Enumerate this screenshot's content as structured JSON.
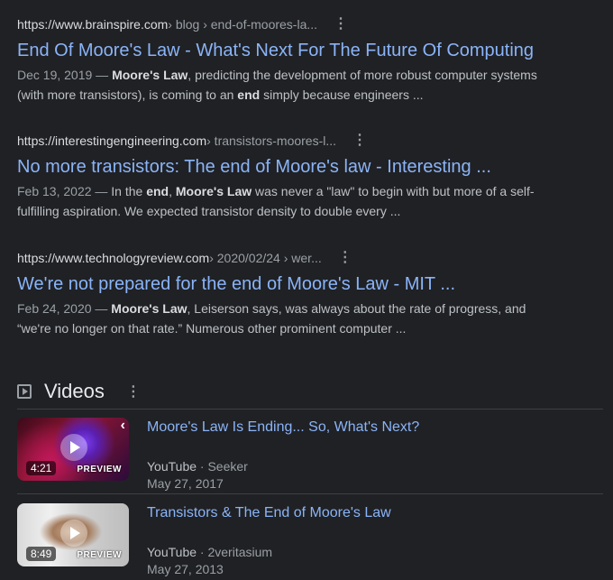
{
  "results": [
    {
      "domain": "https://www.brainspire.com",
      "path": " › blog › end-of-moores-la...",
      "title": "End Of Moore's Law - What's Next For The Future Of Computing",
      "date": "Dec 19, 2019 — ",
      "snippet_parts": [
        {
          "b": true,
          "t": "Moore's Law"
        },
        {
          "b": false,
          "t": ", predicting the development of more robust computer systems (with more transistors), is coming to an "
        },
        {
          "b": true,
          "t": "end"
        },
        {
          "b": false,
          "t": " simply because engineers ..."
        }
      ]
    },
    {
      "domain": "https://interestingengineering.com",
      "path": " › transistors-moores-l...",
      "title": "No more transistors: The end of Moore's law - Interesting ...",
      "date": "Feb 13, 2022 — ",
      "snippet_parts": [
        {
          "b": false,
          "t": "In the "
        },
        {
          "b": true,
          "t": "end"
        },
        {
          "b": false,
          "t": ", "
        },
        {
          "b": true,
          "t": "Moore's Law"
        },
        {
          "b": false,
          "t": " was never a \"law\" to begin with but more of a self-fulfilling aspiration. We expected transistor density to double every ..."
        }
      ]
    },
    {
      "domain": "https://www.technologyreview.com",
      "path": " › 2020/02/24 › wer...",
      "title": "We're not prepared for the end of Moore's Law - MIT ...",
      "date": "Feb 24, 2020 — ",
      "snippet_parts": [
        {
          "b": true,
          "t": "Moore's Law"
        },
        {
          "b": false,
          "t": ", Leiserson says, was always about the rate of progress, and “we're no longer on that rate.” Numerous other prominent computer ..."
        }
      ]
    }
  ],
  "more_icon": "⋮",
  "videos": {
    "heading": "Videos",
    "items": [
      {
        "title": "Moore's Law Is Ending... So, What's Next?",
        "source": "YouTube",
        "separator": " · ",
        "channel": "Seeker",
        "date": "May 27, 2017",
        "duration": "4:21",
        "preview": "PREVIEW"
      },
      {
        "title": "Transistors & The End of Moore's Law",
        "source": "YouTube",
        "separator": " · ",
        "channel": "2veritasium",
        "date": "May 27, 2013",
        "duration": "8:49",
        "preview": "PREVIEW"
      }
    ]
  },
  "colors": {
    "background": "#202124",
    "link": "#8ab4f8",
    "text": "#bdc1c6",
    "muted": "#9aa0a6"
  }
}
